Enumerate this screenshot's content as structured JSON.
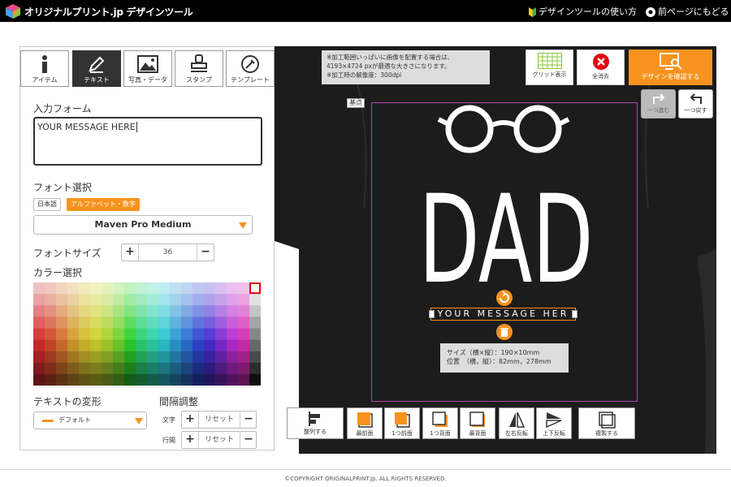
{
  "header": {
    "logo_text": "オリジナルプリント.jp デザインツール",
    "help_link": "デザインツールの使い方",
    "back_link": "前ページにもどる"
  },
  "tabs": [
    {
      "label": "アイテム",
      "icon": "info-icon"
    },
    {
      "label": "テキスト",
      "icon": "pen-icon"
    },
    {
      "label": "写真・データ",
      "icon": "image-icon"
    },
    {
      "label": "スタンプ",
      "icon": "stamp-icon"
    },
    {
      "label": "テンプレート",
      "icon": "template-icon"
    }
  ],
  "text_panel": {
    "input_label": "入力フォーム",
    "input_value": "YOUR MESSAGE HERE",
    "font_label": "フォント選択",
    "font_tab_jp": "日本語",
    "font_tab_alpha": "アルファベット・数字",
    "font_selected": "Maven Pro Medium",
    "size_label": "フォントサイズ",
    "size_value": "36",
    "color_label": "カラー選択",
    "transform_label": "テキストの変形",
    "transform_value": "デフォルト",
    "spacing_label": "間隔調整",
    "char_label": "文字",
    "line_label": "行間",
    "reset_label": "リセット"
  },
  "canvas": {
    "note_lines": [
      "※加工範囲いっぱいに画像を配置する場合は、",
      "4193×4724 pxが最適な大きさになります。",
      "※加工時の解像度：300dpi"
    ],
    "grid_button": "グリッド表示",
    "clear_button": "全消去",
    "confirm_button": "デザインを確認する",
    "redo_button": "一つ進む",
    "undo_button": "一つ戻す",
    "origin_label": "基点",
    "design_main_text": "DAD",
    "design_sub_text": "YOUR MESSAGE HER",
    "size_info": "サイズ（横×縦）：190×10mm",
    "position_info": "位置　（横，縦）：82mm，278mm",
    "colors": {
      "shirt": "#1a1a1a",
      "accent": "#f7931e",
      "print_area": "#b04ab0"
    }
  },
  "bottom_toolbar": [
    {
      "label": "整列する"
    },
    {
      "label": "最前面"
    },
    {
      "label": "1つ前面"
    },
    {
      "label": "1つ背面"
    },
    {
      "label": "最背面"
    },
    {
      "label": "左右反転"
    },
    {
      "label": "上下反転"
    },
    {
      "label": "複製する"
    }
  ],
  "footer": {
    "copyright": "©COPYRIGHT ORIGINALPRINT.jp. ALL RIGHTS RESERVED."
  }
}
